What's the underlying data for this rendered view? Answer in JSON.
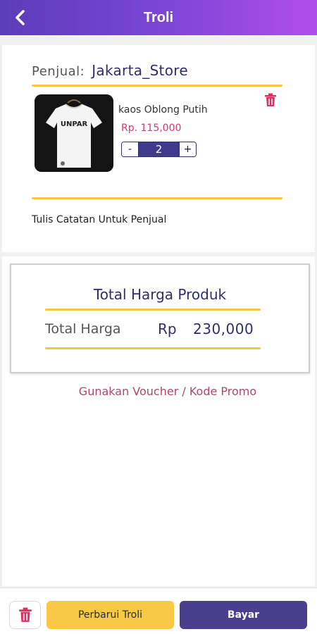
{
  "header": {
    "title": "Troli",
    "back_icon": "chevron-left-icon"
  },
  "store": {
    "seller_label": "Penjual:",
    "seller_name": "Jakarta_Store",
    "product": {
      "name": "kaos Oblong Putih",
      "price": "Rp. 115,000",
      "quantity": "2",
      "minus_label": "-",
      "plus_label": "+",
      "shirt_print": "UNPAR"
    },
    "note_label": "Tulis Catatan Untuk Penjual"
  },
  "summary": {
    "title": "Total Harga Produk",
    "total_label": "Total Harga",
    "currency": "Rp",
    "total_value": "230,000"
  },
  "voucher_label": "Gunakan Voucher / Kode Promo",
  "bottom": {
    "update_label": "Perbarui Troli",
    "pay_label": "Bayar"
  },
  "colors": {
    "accent_yellow": "#f5c842",
    "brand_purple": "#4a3f8f",
    "price_pink": "#d9386a",
    "trash_pink": "#e0305f"
  }
}
